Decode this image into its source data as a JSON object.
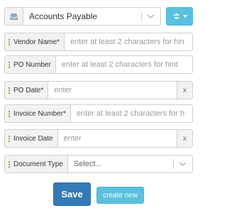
{
  "top": {
    "selected": "Accounts Payable",
    "icon": "inbox-tray-icon",
    "refresh_icon": "refresh-icon"
  },
  "fields": {
    "vendor_name": {
      "label": "Vendor Name*",
      "placeholder": "enter at least 2 characters for hin"
    },
    "po_number": {
      "label": "PO Number",
      "placeholder": "enter at least 2 characters for hint"
    },
    "po_date": {
      "label": "PO Date*",
      "placeholder": "enter",
      "clear": "x"
    },
    "invoice_number": {
      "label": "Invoice Number*",
      "placeholder": "enter at least 2 characters for h"
    },
    "invoice_date": {
      "label": "Invoice Date",
      "placeholder": "enter",
      "clear": "x"
    },
    "document_type": {
      "label": "Document Type",
      "value": "Select..."
    }
  },
  "actions": {
    "save": "Save",
    "create_new": "create new"
  },
  "colors": {
    "primary": "#337ab7",
    "info": "#5bc0de",
    "grip": "#c0922c"
  }
}
